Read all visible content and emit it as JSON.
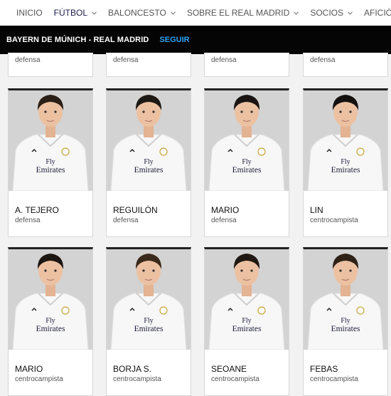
{
  "nav": {
    "items": [
      {
        "label": "INICIO",
        "has_menu": false
      },
      {
        "label": "FÚTBOL",
        "has_menu": true,
        "active": true
      },
      {
        "label": "BALONCESTO",
        "has_menu": true
      },
      {
        "label": "SOBRE EL REAL MADRID",
        "has_menu": true
      },
      {
        "label": "SOCIOS",
        "has_menu": true
      },
      {
        "label": "AFICIÓN",
        "has_menu": true
      }
    ]
  },
  "match": {
    "title": "BAYERN DE MÚNICH - REAL MADRID",
    "follow_label": "SEGUIR"
  },
  "partial_row": [
    {
      "position": "defensa"
    },
    {
      "position": "defensa"
    },
    {
      "position": "defensa"
    },
    {
      "position": "defensa"
    }
  ],
  "players": [
    {
      "name": "A. TEJERO",
      "position": "defensa",
      "hair": "#2a1f17"
    },
    {
      "name": "REGUILÓN",
      "position": "defensa",
      "hair": "#1e1814"
    },
    {
      "name": "MARIO",
      "position": "defensa",
      "hair": "#1a1512"
    },
    {
      "name": "LIN",
      "position": "centrocampista",
      "hair": "#141010"
    },
    {
      "name": "MARIO",
      "position": "centrocampista",
      "hair": "#1c1612"
    },
    {
      "name": "BORJA S.",
      "position": "centrocampista",
      "hair": "#3a2a1c"
    },
    {
      "name": "SEOANE",
      "position": "centrocampista",
      "hair": "#1f1813"
    },
    {
      "name": "FEBAS",
      "position": "centrocampista",
      "hair": "#2e2218"
    }
  ],
  "jersey": {
    "sponsor_line1": "Fly",
    "sponsor_line2": "Emirates"
  },
  "colors": {
    "nav_active": "#1a1a4a",
    "match_bar": "#050505",
    "follow": "#2ea3f2"
  }
}
